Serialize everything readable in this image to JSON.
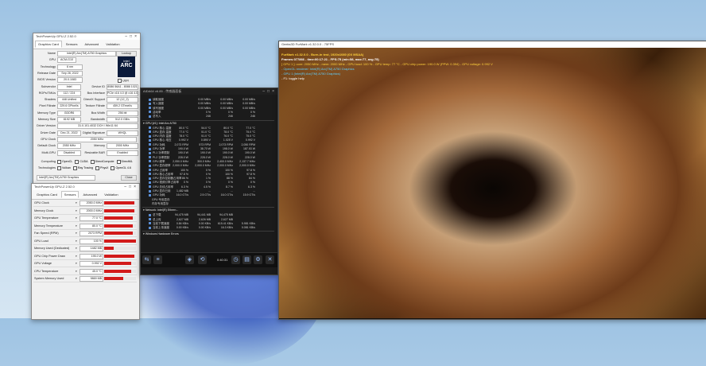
{
  "gpuz": {
    "title": "TechPowerUp GPU-Z 2.52.0",
    "tabs": [
      "Graphics Card",
      "Sensors",
      "Advanced",
      "Validation"
    ],
    "lookup": "Lookup",
    "uefi": "UEFI",
    "fields": [
      {
        "label": "Name",
        "value": "Intel(R) Arc(TM) A750 Graphics"
      },
      {
        "label": "GPU",
        "value": "ACM-G10"
      },
      {
        "label": "Technology",
        "value": "6 nm"
      },
      {
        "label": "Release Date",
        "value": "Sep 28, 2022"
      },
      {
        "label": "BIOS Version",
        "value": "20.0.1083"
      },
      {
        "label": "Subvendor",
        "value": "Intel"
      },
      {
        "label": "ROPs/TMUs",
        "value": "112 / 224"
      },
      {
        "label": "Shaders",
        "value": "448 Unified"
      },
      {
        "label": "Pixel Fillrate",
        "value": "229.6 GPixel/s"
      },
      {
        "label": "Memory Type",
        "value": "GDDR6"
      },
      {
        "label": "Memory Size",
        "value": "8192 MB"
      },
      {
        "label": "Driver Version",
        "value": "31.0.101.4032 DCH / Win11 64"
      },
      {
        "label": "Driver Date",
        "value": "Dec 21, 2022"
      },
      {
        "label": "GPU Clock",
        "value": "2050 MHz"
      },
      {
        "label": "Default Clock",
        "value": "2050 MHz"
      },
      {
        "label": "Multi-GPU",
        "value": "Disabled"
      }
    ],
    "right_fields": [
      {
        "label": "Device ID",
        "value": "8086 56A1 - 8086 1021"
      },
      {
        "label": "Bus Interface",
        "value": "PCIe x16 4.0 @ x16 4.0"
      },
      {
        "label": "DirectX Support",
        "value": "12 (12_2)"
      },
      {
        "label": "Texture Fillrate",
        "value": "459.2 GTexel/s"
      },
      {
        "label": "Bus Width",
        "value": "256 bit"
      },
      {
        "label": "Bandwidth",
        "value": "512.0 GB/s"
      },
      {
        "label": "Digital Signature",
        "value": "WHQL"
      },
      {
        "label": "Memory",
        "value": "2000 MHz"
      },
      {
        "label": "Resizable BAR",
        "value": "Enabled"
      }
    ],
    "computing_label": "Computing",
    "computing": [
      "OpenCL",
      "CUDA",
      "DirectCompute",
      "DirectML"
    ],
    "technologies_label": "Technologies",
    "technologies": [
      "Vulkan",
      "Ray Tracing",
      "PhysX",
      "OpenGL 4.6"
    ],
    "footer_name": "Intel(R) Arc(TM) A750 Graphics"
  },
  "sensors": {
    "title": "TechPowerUp GPU-Z 2.52.0",
    "tabs": [
      "Graphics Card",
      "Sensors",
      "Advanced",
      "Validation"
    ],
    "rows": [
      {
        "name": "GPU Clock",
        "value": "2050.0 MHz",
        "fill": 0.95
      },
      {
        "name": "Memory Clock",
        "value": "2000.0 MHz",
        "fill": 0.95
      },
      {
        "name": "GPU Temperature",
        "value": "77.0 °C",
        "fill": 0.9
      },
      {
        "name": "Memory Temperature",
        "value": "80.0 °C",
        "fill": 0.9
      },
      {
        "name": "Fan Speed (RPM)",
        "value": "2073 RPM",
        "fill": 0.9
      },
      {
        "name": "GPU Load",
        "value": "100 %",
        "fill": 1.0
      },
      {
        "name": "Memory Used (Dedicated)",
        "value": "1482 MB",
        "fill": 0.3
      },
      {
        "name": "GPU Chip Power Draw",
        "value": "195.0 W",
        "fill": 0.95
      },
      {
        "name": "GPU Voltage",
        "value": "0.992 V",
        "fill": 0.85
      },
      {
        "name": "CPU Temperature",
        "value": "45.0 °C",
        "fill": 0.85
      },
      {
        "name": "System Memory Used",
        "value": "9869 MB",
        "fill": 0.6
      }
    ]
  },
  "aida": {
    "title": "AIDA64 v6.85 - 传感器面板",
    "disk_rows": [
      {
        "name": "读取速度",
        "v": [
          "0.00 MB/s",
          "0.00 MB/s",
          "0.00 MB/s"
        ]
      },
      {
        "name": "写入速度",
        "v": [
          "0.00 MB/s",
          "0.00 MB/s",
          "0.00 MB/s"
        ]
      },
      {
        "name": "读写速度",
        "v": [
          "0.00 MB/s",
          "0.00 MB/s",
          "0.00 MB/s"
        ]
      },
      {
        "name": "活动率",
        "v": [
          "0 %",
          "0 %",
          "0 %"
        ]
      },
      {
        "name": "总写入",
        "v": [
          "246",
          "246",
          "246"
        ]
      }
    ],
    "gpu_group": "GPU [#1]: Intel Arc A750",
    "gpu_rows": [
      {
        "name": "GPU 核心 温度",
        "v": [
          "80.0 °C",
          "54.0 °C",
          "80.0 °C",
          "77.0 °C"
        ]
      },
      {
        "name": "GPU 显存 温度",
        "v": [
          "77.0 °C",
          "51.0 °C",
          "78.0 °C",
          "75.0 °C"
        ]
      },
      {
        "name": "GPU 内存 温度",
        "v": [
          "78.0 °C",
          "51.0 °C",
          "76.0 °C",
          "75.0 °C"
        ]
      },
      {
        "name": "GPU 核心 电压",
        "v": [
          "0.992 V",
          "0.890 V",
          "1.025 V",
          "0.992 V"
        ]
      },
      {
        "name": "GPU 功耗",
        "v": [
          "2,073 RPM",
          "573 RPM",
          "2,073 RPM",
          "2,050 RPM"
        ]
      },
      {
        "name": "GPU 功率",
        "v": [
          "190.0 W",
          "38.70 W",
          "198.0 W",
          "187.53 W"
        ]
      },
      {
        "name": "PL1 功率限制",
        "v": [
          "190.0 W",
          "190.0 W",
          "190.0 W",
          "190.0 W"
        ]
      },
      {
        "name": "PL2 功率限制",
        "v": [
          "228.0 W",
          "228.0 W",
          "228.0 W",
          "228.0 W"
        ]
      },
      {
        "name": "GPU 频率",
        "v": [
          "2,050.0 MHz",
          "300.0 MHz",
          "2,400.0 MHz",
          "2,137.7 MHz"
        ]
      },
      {
        "name": "GPU 显存频率",
        "v": [
          "2,000.0 MHz",
          "2,000.0 MHz",
          "2,000.0 MHz",
          "2,000.0 MHz"
        ]
      },
      {
        "name": "GPU 占用率",
        "v": [
          "100 %",
          "0 %",
          "100 %",
          "97.8 %"
        ]
      },
      {
        "name": "GPU 核心占用率",
        "v": [
          "97.8 %",
          "0 %",
          "100 %",
          "97.8 %"
        ]
      },
      {
        "name": "GPU 显存控制器占用率",
        "v": [
          "86 %",
          "1 %",
          "88 %",
          "84 %"
        ]
      },
      {
        "name": "GPU 视频引擎占用率",
        "v": [
          "0 %",
          "0 %",
          "0 %",
          "0 %"
        ]
      },
      {
        "name": "GPU 总线占用率",
        "v": [
          "6.3 %",
          "4.5 %",
          "8.7 %",
          "6.3 %"
        ]
      },
      {
        "name": "GPU 显存已用",
        "v": [
          "1,482 MB",
          "...",
          "...",
          "..."
        ]
      },
      {
        "name": "GPU 功耗",
        "v": [
          "16.0 GT/s",
          "2.5 GT/s",
          "16.0 GT/s",
          "15.9 GT/s"
        ]
      }
    ],
    "mem_rows": [
      "GPU 专用显存",
      "内存专用显存"
    ],
    "net_group": "Network: Intel(R) Ethern...",
    "net_rows": [
      {
        "name": "总下载",
        "v": [
          "94,475 MB",
          "94,441 MB",
          "94,475 MB",
          ""
        ]
      },
      {
        "name": "总上传",
        "v": [
          "2,627 MB",
          "2,626 MB",
          "2,627 MB",
          ""
        ]
      },
      {
        "name": "当前下载速度",
        "v": [
          "0.84 KB/s",
          "0.00 KB/s",
          "615.41 KB/s",
          "5.981 KB/s"
        ]
      },
      {
        "name": "当前上传速度",
        "v": [
          "0.00 KB/s",
          "0.00 KB/s",
          "16.3 KB/s",
          "0.081 KB/s"
        ]
      }
    ],
    "hw_group": "Windows Hardware Errors",
    "time": "0:40:31",
    "toolbar_icons": [
      "arrows-icon",
      "bars-icon",
      "sensor-icon",
      "clock-icon",
      "report-icon",
      "settings-icon",
      "close-icon"
    ]
  },
  "furmark": {
    "title": "Geeks3D FurMark v1.32.0.0 - 75FPS",
    "line1": "FurMark v1.32.0.0 - Burn-in test, 1920x1080 (0X MSAA)",
    "line2": "Frames:077866 - time:00:17:21 - FPS:75 (min:58, max:77, avg:75)",
    "line3": "[ GPU 1 ]: core: 2050 MHz - mem: 2000 MHz - GPU load: 100 % - GPU temp: 77 °C - GPU chip power: 190.0 W (PPW: 0.394) - GPU voltage: 0.992 V",
    "line4": "- OpenGL renderer: Intel(R) Arc(TM) A750 Graphics",
    "line5": "- GPU 1 (Intel(R) Arc(TM) A750 Graphics)",
    "line6": "- F1: toggle help"
  },
  "colors": {
    "sensor_bar": "#d21a1a",
    "furmark_yellow": "#ffd23c",
    "furmark_cyan": "#5fd0ff"
  }
}
